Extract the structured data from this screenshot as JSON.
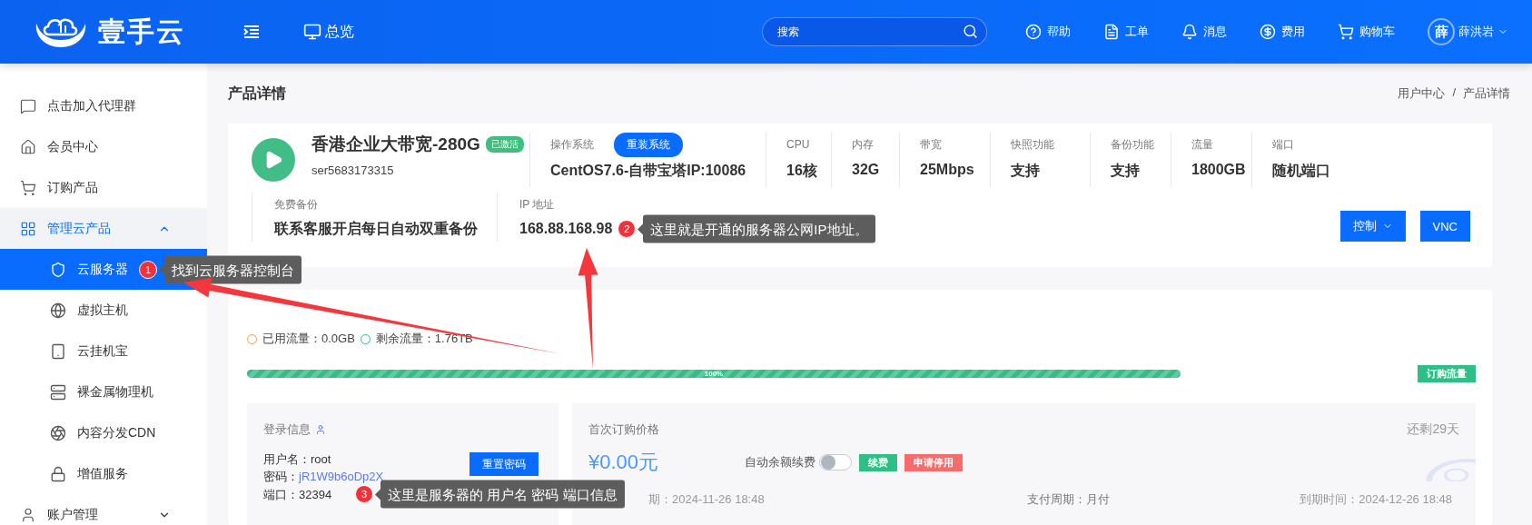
{
  "header": {
    "logo_text": "壹手云",
    "overview": "总览",
    "search": {
      "placeholder": "搜索"
    },
    "nav": [
      {
        "label": "帮助"
      },
      {
        "label": "工单"
      },
      {
        "label": "消息"
      },
      {
        "label": "费用"
      },
      {
        "label": "购物车"
      }
    ],
    "user": {
      "avatar": "薛",
      "name": "薛洪岩"
    }
  },
  "sidebar": {
    "items": [
      {
        "label": "点击加入代理群",
        "selected": false
      },
      {
        "label": "会员中心",
        "selected": false
      },
      {
        "label": "订购产品",
        "selected": false
      },
      {
        "label": "管理云产品",
        "selected": false,
        "expanded": true,
        "children": [
          {
            "label": "云服务器",
            "selected": true,
            "annotation": {
              "number": "1",
              "text": "找到云服务器控制台"
            }
          },
          {
            "label": "虚拟主机",
            "selected": false
          },
          {
            "label": "云挂机宝",
            "selected": false
          },
          {
            "label": "裸金属物理机",
            "selected": false
          },
          {
            "label": "内容分发CDN",
            "selected": false
          },
          {
            "label": "增值服务",
            "selected": false
          }
        ]
      },
      {
        "label": "账户管理",
        "selected": false,
        "expanded": false
      }
    ]
  },
  "page_title": "产品详情",
  "breadcrumb": [
    "用户中心",
    "/",
    "产品详情"
  ],
  "product": {
    "name": "香港企业大带宽-280G",
    "status": "已激活",
    "id": "ser5683173315",
    "os": {
      "label": "操作系统",
      "button": "重装系统",
      "value": "CentOS7.6-自带宝塔IP:10086"
    },
    "specs": [
      {
        "label": "CPU",
        "value": "16核"
      },
      {
        "label": "内存",
        "value": "32G"
      },
      {
        "label": "带宽",
        "value": "25Mbps"
      },
      {
        "label": "快照功能",
        "value": "支持"
      },
      {
        "label": "备份功能",
        "value": "支持"
      },
      {
        "label": "流量",
        "value": "1800GB"
      },
      {
        "label": "端口",
        "value": "随机端口"
      }
    ],
    "backup": {
      "label": "免费备份",
      "value": "联系客服开启每日自动双重备份"
    },
    "ip": {
      "label": "IP 地址",
      "value": "168.88.168.98",
      "annotation": {
        "number": "2",
        "text": "这里就是开通的服务器公网IP地址。"
      }
    },
    "buttons": [
      "控制",
      "VNC"
    ]
  },
  "traffic": {
    "used": "已用流量：0.0GB",
    "remaining": "剩余流量：1.76TB",
    "level": 1,
    "bar_label": "100%",
    "buy_button": "订购流量"
  },
  "login": {
    "title": "登录信息",
    "username": "用户名：root",
    "password_label": "密码：",
    "password": "jR1W9b6oDp2X",
    "port": "端口：32394",
    "reset_button": "重置密码",
    "annotation": {
      "number": "3",
      "text": "这里是服务器的 用户名 密码  端口信息"
    }
  },
  "pricing": {
    "title": "首次订购价格",
    "days_left": "还剩29天",
    "price": "¥0.00元",
    "auto_renew": {
      "label": "自动余额续费",
      "on": false
    },
    "renew_button": "续费",
    "stop_button": "申请停用",
    "first_date": "期：2024-11-26 18:48",
    "cycle": "支付周期：月付",
    "expiry": "到期时间：2024-12-26 18:48"
  }
}
